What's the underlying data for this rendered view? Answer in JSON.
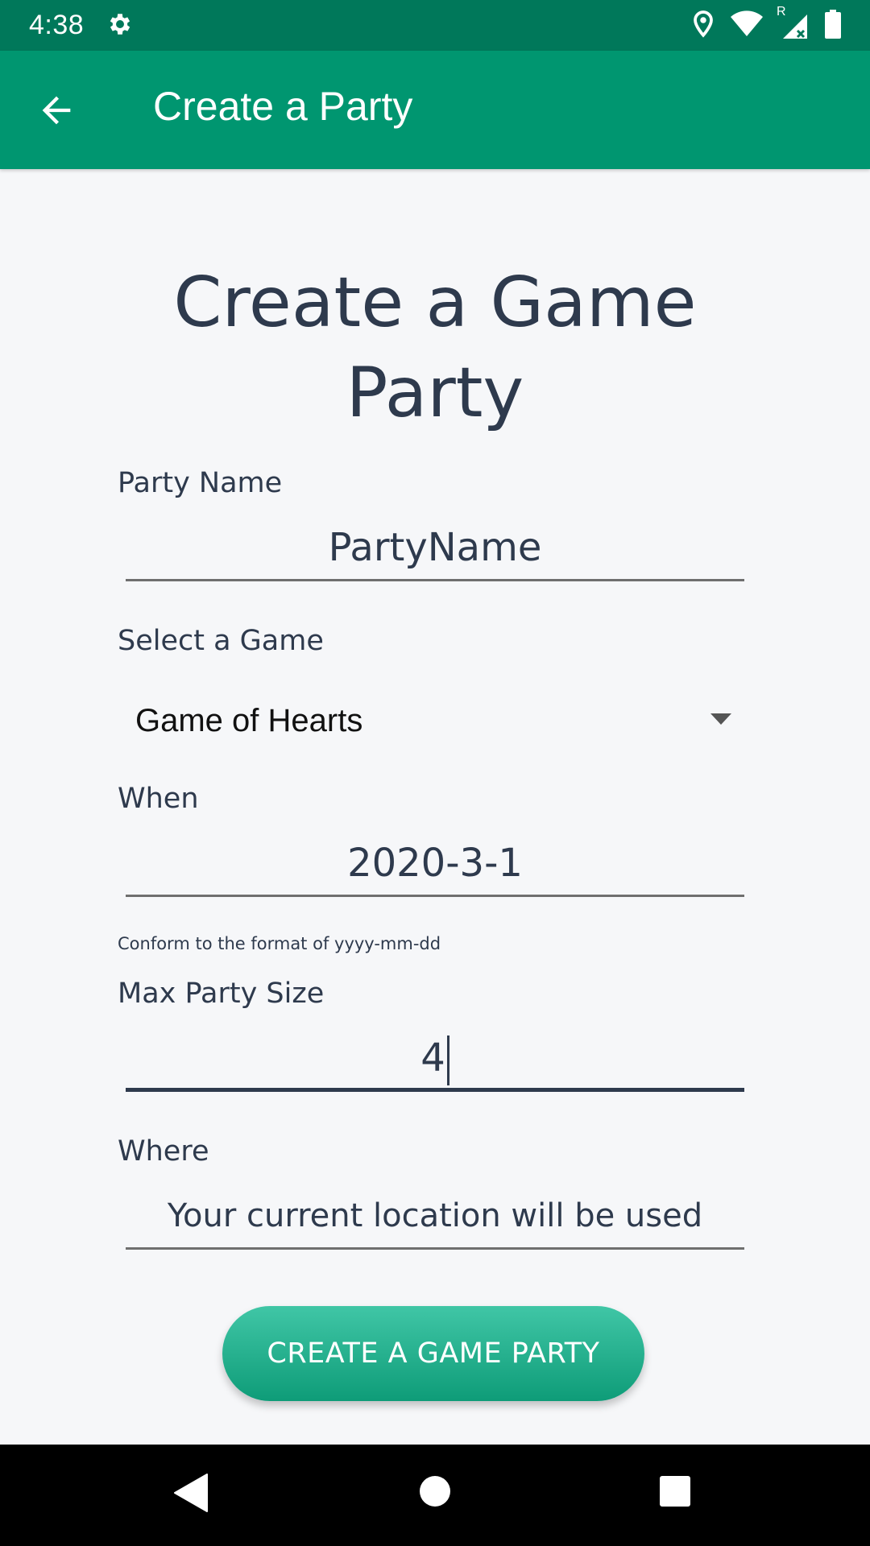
{
  "status_bar": {
    "time": "4:38",
    "icons": [
      "settings-icon",
      "location-icon",
      "wifi-icon",
      "signal-roaming-icon",
      "battery-icon"
    ],
    "roaming_indicator": "R"
  },
  "app_bar": {
    "title": "Create a Party",
    "back_icon": "arrow-back-icon",
    "color": "#009670",
    "status_color": "#00785a"
  },
  "form": {
    "heading": "Create a Game Party",
    "party_name": {
      "label": "Party Name",
      "value": "PartyName"
    },
    "game": {
      "label": "Select a Game",
      "selected": "Game of Hearts"
    },
    "when": {
      "label": "When",
      "value": "2020-3-1",
      "hint": "Conform to the format of yyyy-mm-dd"
    },
    "max_size": {
      "label": "Max Party Size",
      "value": "4"
    },
    "where": {
      "label": "Where",
      "value": "Your current location will be used"
    },
    "submit_label": "CREATE A GAME PARTY",
    "text_color": "#2e3a4d",
    "accent": "#0e9c78"
  },
  "nav_bar": {
    "icons": [
      "nav-back-icon",
      "nav-home-icon",
      "nav-recents-icon"
    ]
  }
}
